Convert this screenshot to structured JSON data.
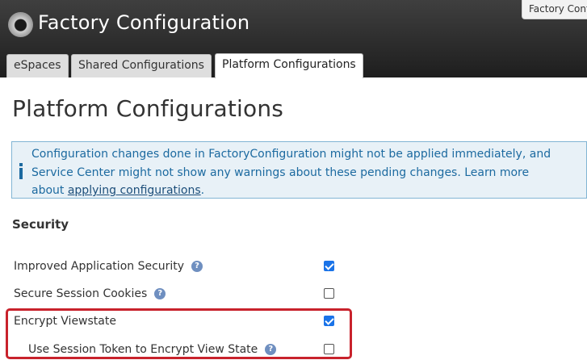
{
  "header": {
    "title": "Factory Configuration",
    "corner_tab": "Factory Configu"
  },
  "tabs": [
    {
      "label": "eSpaces",
      "active": false
    },
    {
      "label": "Shared Configurations",
      "active": false
    },
    {
      "label": "Platform Configurations",
      "active": true
    }
  ],
  "page": {
    "title": "Platform Configurations"
  },
  "notice": {
    "text_before": "Configuration changes done in FactoryConfiguration might not be applied immediately, and Service Center might not show any warnings about these pending changes. Learn more about ",
    "link": "applying configurations",
    "text_after": "."
  },
  "security": {
    "heading": "Security",
    "help_glyph": "?",
    "settings": [
      {
        "label": "Improved Application Security",
        "checked": true
      },
      {
        "label": "Secure Session Cookies",
        "checked": false
      },
      {
        "label": "Encrypt Viewstate",
        "checked": true
      },
      {
        "label": "Use Session Token to Encrypt View State",
        "checked": false
      }
    ]
  },
  "colors": {
    "accent": "#1a73e8",
    "highlight": "#c8222c",
    "info_text": "#1c6aa0"
  }
}
